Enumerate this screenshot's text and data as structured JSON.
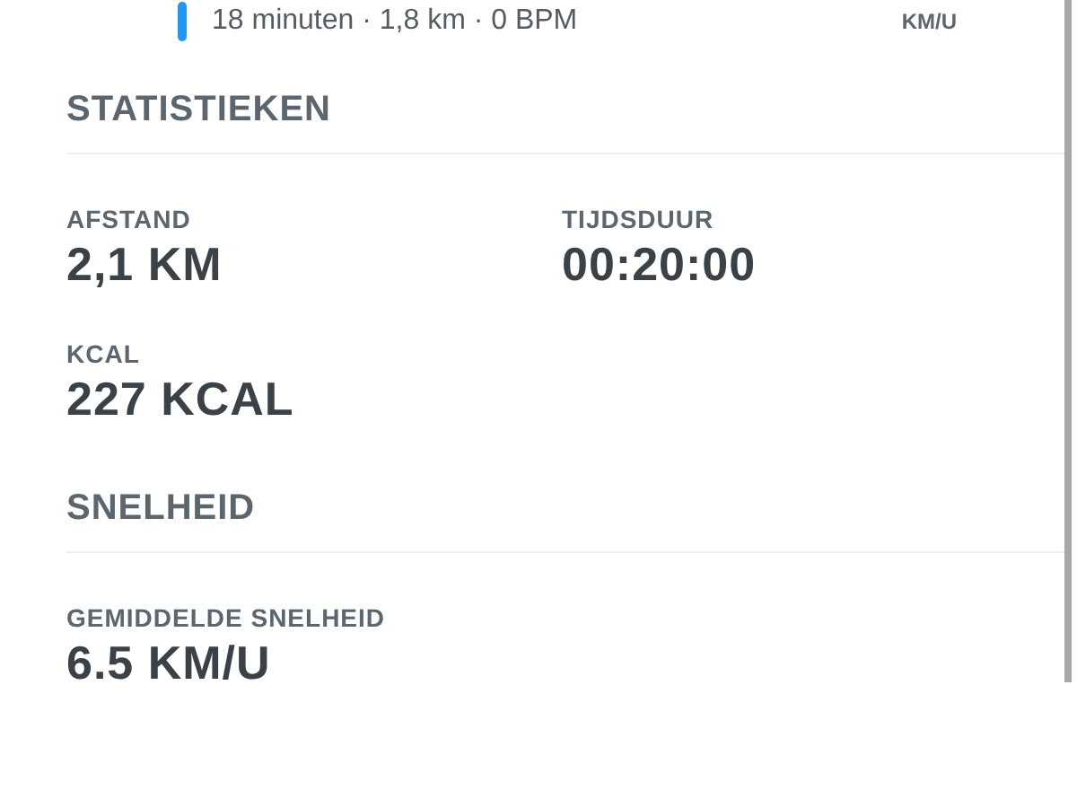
{
  "previous_interval": {
    "summary": "18 minuten · 1,8 km · 0 BPM",
    "unit": "KM/U"
  },
  "sections": [
    {
      "title": "STATISTIEKEN",
      "stats": [
        {
          "label": "AFSTAND",
          "value": "2,1 KM"
        },
        {
          "label": "TIJDSDUUR",
          "value": "00:20:00"
        },
        {
          "label": "KCAL",
          "value": "227 KCAL"
        }
      ]
    },
    {
      "title": "SNELHEID",
      "stats": [
        {
          "label": "GEMIDDELDE SNELHEID",
          "value": "6.5 KM/U"
        }
      ]
    }
  ]
}
